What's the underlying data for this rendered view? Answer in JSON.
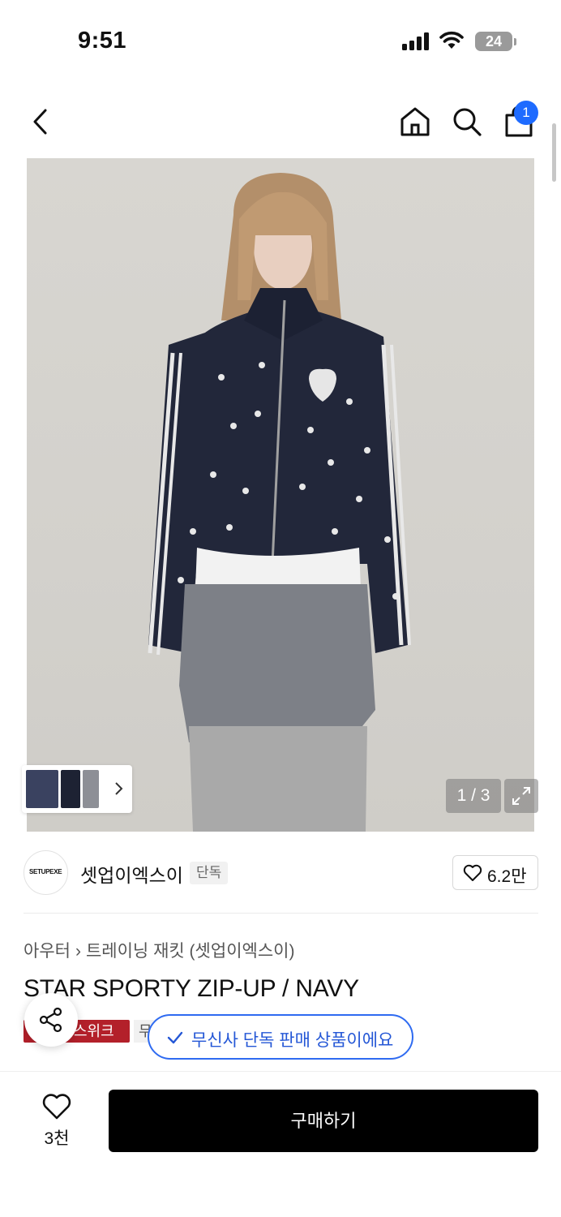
{
  "status_bar": {
    "time": "9:51",
    "battery": "24"
  },
  "nav": {
    "cart_count": "1"
  },
  "gallery": {
    "counter": "1 / 3"
  },
  "brand": {
    "name": "셋업이엑스이",
    "logo_text": "SETUPEXE",
    "exclusive_tag": "단독",
    "likes": "6.2만"
  },
  "product": {
    "breadcrumb": [
      "아우터",
      "트레이닝 재킷 (셋업이엑스이)"
    ],
    "title": "STAR SPORTY ZIP-UP / NAVY",
    "tag_red": "스위크",
    "tag_grey": "무"
  },
  "toast": {
    "message": "무신사 단독 판매 상품이에요"
  },
  "bottom_bar": {
    "wish_count": "3천",
    "buy_label": "구매하기"
  },
  "colors": {
    "accent_blue": "#2f6bf1",
    "badge_blue": "#1e6bff",
    "tag_red": "#b3202a",
    "buy_black": "#000000"
  },
  "icons": [
    "back-icon",
    "home-icon",
    "search-icon",
    "shopping-bag-icon",
    "expand-icon",
    "heart-icon",
    "share-icon",
    "check-icon",
    "chevron-right-icon"
  ]
}
